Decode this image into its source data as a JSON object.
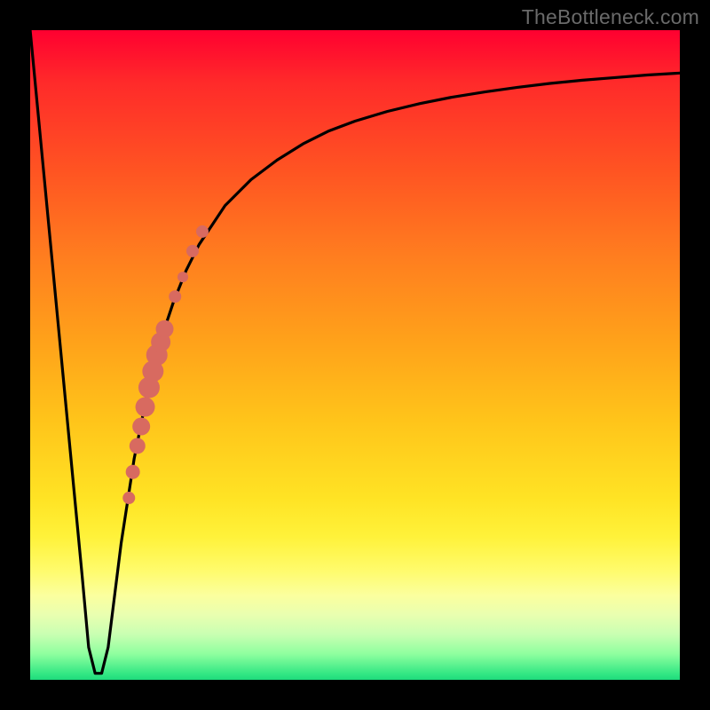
{
  "watermark": "TheBottleneck.com",
  "colors": {
    "frame": "#000000",
    "curve": "#000000",
    "marker": "#d86a60",
    "gradient_top": "#ff0030",
    "gradient_bottom": "#1edb7d"
  },
  "chart_data": {
    "type": "line",
    "title": "",
    "xlabel": "",
    "ylabel": "",
    "xlim": [
      0,
      100
    ],
    "ylim": [
      0,
      100
    ],
    "series": [
      {
        "name": "bottleneck-curve",
        "x": [
          0,
          2,
          4,
          6,
          8,
          9,
          10,
          11,
          12,
          13,
          14,
          16,
          18,
          20,
          22,
          24,
          26,
          28,
          30,
          34,
          38,
          42,
          46,
          50,
          55,
          60,
          65,
          70,
          75,
          80,
          85,
          90,
          95,
          100
        ],
        "y": [
          100,
          79,
          58,
          37,
          16,
          5,
          1,
          1,
          5,
          13,
          21,
          34,
          44,
          52,
          58,
          63,
          67,
          70,
          73,
          77,
          80,
          82.5,
          84.5,
          86,
          87.5,
          88.7,
          89.7,
          90.5,
          91.2,
          91.8,
          92.3,
          92.7,
          93.1,
          93.4
        ]
      }
    ],
    "markers": {
      "name": "highlighted-points",
      "x": [
        15.2,
        15.8,
        16.5,
        17.1,
        17.7,
        18.3,
        18.9,
        19.5,
        20.1,
        20.7,
        22.3,
        23.5,
        25.0,
        26.5
      ],
      "y": [
        28,
        32,
        36,
        39,
        42,
        45,
        47.5,
        50,
        52,
        54,
        59,
        62,
        66,
        69
      ],
      "sizes": [
        7,
        8,
        9,
        10,
        11,
        12,
        12,
        12,
        11,
        10,
        7,
        6,
        7,
        7
      ]
    }
  }
}
